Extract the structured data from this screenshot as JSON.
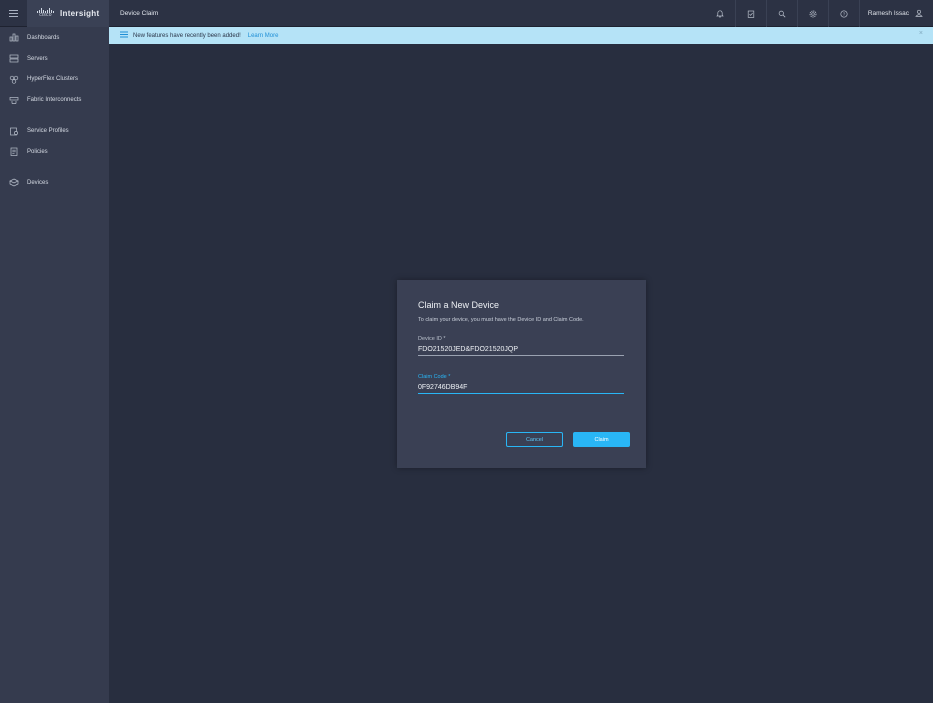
{
  "brand": {
    "logo_text": "cisco",
    "name": "Intersight"
  },
  "header": {
    "title": "Device Claim",
    "user_name": "Ramesh Issac",
    "icons": [
      "bell-icon",
      "clipboard-check-icon",
      "search-icon",
      "gear-icon",
      "help-icon"
    ]
  },
  "sidebar": {
    "items": [
      {
        "label": "Dashboards",
        "icon": "dashboard-icon"
      },
      {
        "label": "Servers",
        "icon": "server-icon"
      },
      {
        "label": "HyperFlex Clusters",
        "icon": "cluster-icon"
      },
      {
        "label": "Fabric Interconnects",
        "icon": "fabric-icon"
      },
      {
        "label": "Service Profiles",
        "icon": "service-profile-icon"
      },
      {
        "label": "Policies",
        "icon": "policy-icon"
      },
      {
        "label": "Devices",
        "icon": "devices-icon"
      }
    ]
  },
  "banner": {
    "message": "New features have recently been added!",
    "link": "Learn More",
    "close": "×"
  },
  "dialog": {
    "title": "Claim a New Device",
    "description": "To claim your device, you must have the Device ID and Claim Code.",
    "device_id_label": "Device ID *",
    "device_id_value": "FDO21520JED&FDO21520JQP",
    "claim_code_label": "Claim Code *",
    "claim_code_value": "0F92746DB94F",
    "cancel_label": "Cancel",
    "claim_label": "Claim"
  },
  "colors": {
    "accent": "#29b6f6",
    "banner_bg": "#b5e3f7",
    "background": "#282e3f",
    "sidebar_bg": "#353b4e",
    "dialog_bg": "#3a4054"
  }
}
